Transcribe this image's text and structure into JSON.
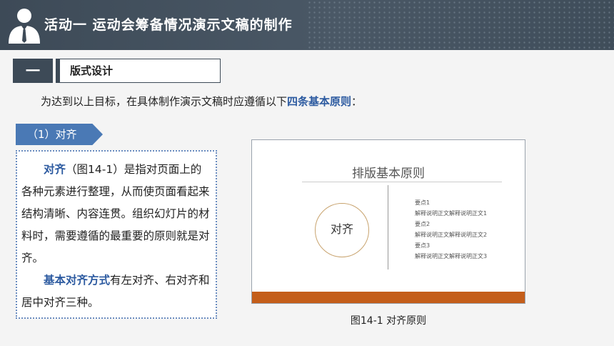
{
  "header": {
    "title": "活动一  运动会筹备情况演示文稿的制作",
    "avatar_icon": "businessman-icon"
  },
  "section": {
    "number": "一",
    "label": "版式设计"
  },
  "intro": {
    "text": "为达到以上目标，在具体制作演示文稿时应遵循以下",
    "highlight": "四条基本原则",
    "suffix": "："
  },
  "tag": {
    "label": "（1）对齐"
  },
  "body": {
    "p1_highlight": "对齐",
    "p1_text": "（图14-1）是指对页面上的各种元素进行整理，从而使页面看起来结构清晰、内容连贯。组织幻灯片的材料时，需要遵循的最重要的原则就是对齐。",
    "p2_highlight": "基本对齐方式",
    "p2_text": "有左对齐、右对齐和居中对齐三种。"
  },
  "slide": {
    "title": "排版基本原则",
    "circle_label": "对齐",
    "points": [
      "要点1",
      "解释说明正文解释说明正文1",
      "要点2",
      "解释说明正文解释说明正文2",
      "要点3",
      "解释说明正文解释说明正文3"
    ]
  },
  "caption": "图14-1  对齐原则",
  "colors": {
    "header_bg": "#3d4a57",
    "accent_blue": "#2c5aa0",
    "tag_blue": "#4a79b5",
    "slide_footer": "#c45e1a"
  }
}
